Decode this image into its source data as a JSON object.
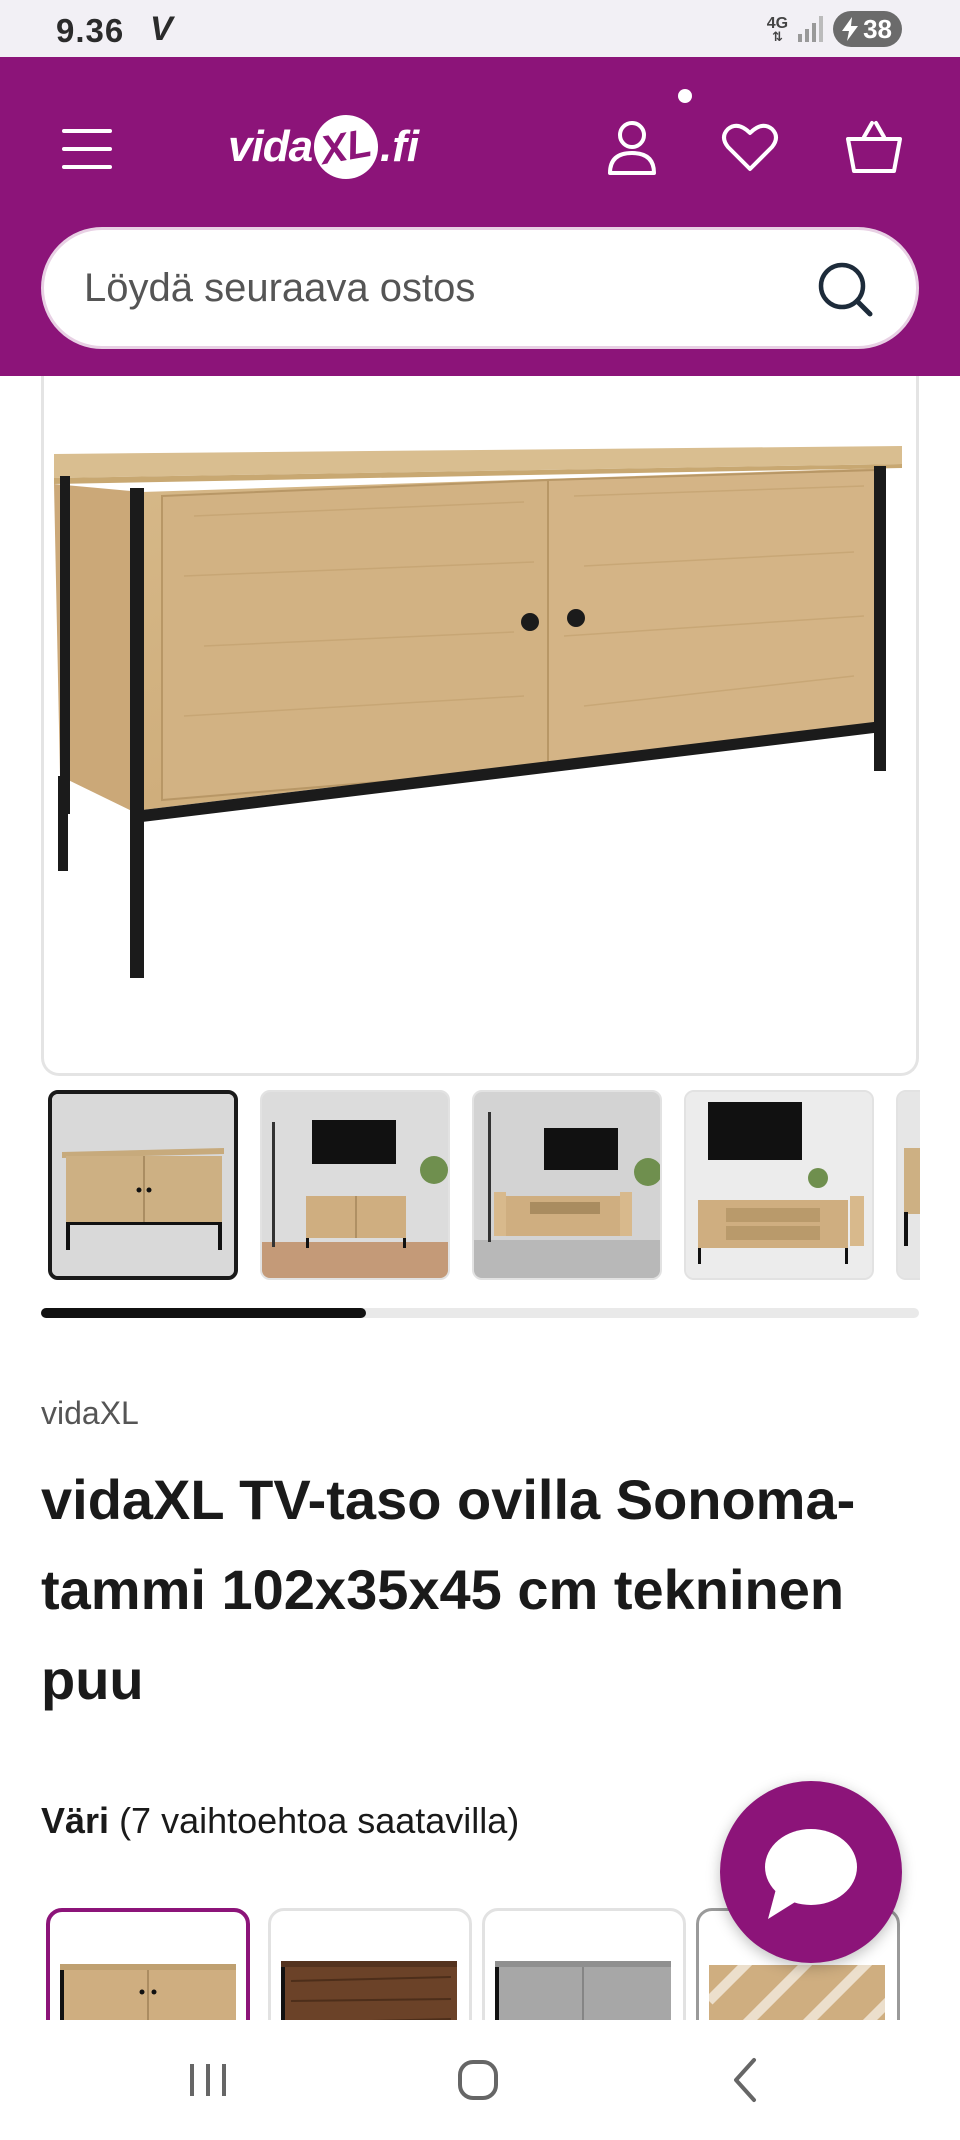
{
  "status_bar": {
    "time": "9.36",
    "carrier_glyph": "V",
    "network": "4G",
    "battery": "38",
    "icons": [
      "signal-icon",
      "battery-charging-icon"
    ]
  },
  "header": {
    "logo": "vidaXL.fi",
    "icons": [
      "menu-icon",
      "account-icon",
      "wishlist-heart-icon",
      "basket-icon"
    ],
    "search_placeholder": "Löydä seuraava ostos",
    "color": "#8c1479"
  },
  "gallery": {
    "main_image": "tv-stand-sonoma-oak-product-image",
    "thumbnails": [
      {
        "name": "thumbnail-product-front",
        "active": true
      },
      {
        "name": "thumbnail-room-closed-doors",
        "active": false
      },
      {
        "name": "thumbnail-room-open-doors",
        "active": false
      },
      {
        "name": "thumbnail-tv-wall-open",
        "active": false
      },
      {
        "name": "thumbnail-partial",
        "active": false
      }
    ],
    "scroll_progress": 0.37
  },
  "product": {
    "brand": "vidaXL",
    "title": "vidaXL TV-taso ovilla Sonoma-tammi 102x35x45 cm tekninen puu"
  },
  "color_selector": {
    "label": "Väri",
    "options_text": "(7 vaihtoehtoa saatavilla)",
    "swatches": [
      {
        "name": "swatch-sonoma-oak",
        "active": true
      },
      {
        "name": "swatch-smoked-oak",
        "active": false
      },
      {
        "name": "swatch-grey-sonoma",
        "active": false
      },
      {
        "name": "swatch-unavailable",
        "active": false
      }
    ]
  },
  "chat": {
    "icon": "chat-bubble-icon"
  },
  "nav_bar": {
    "icons": [
      "recent-apps-icon",
      "home-icon",
      "back-icon"
    ]
  }
}
